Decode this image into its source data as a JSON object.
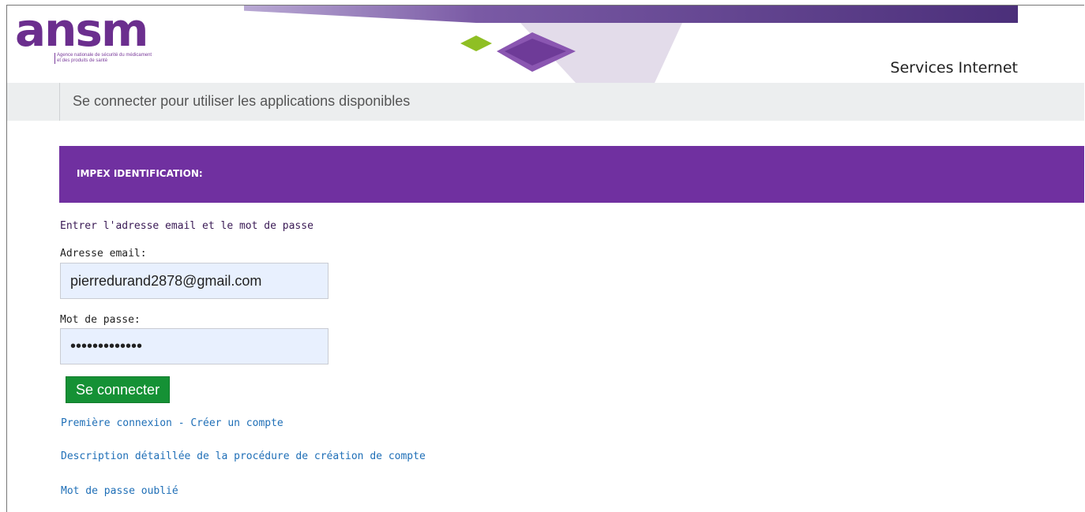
{
  "header": {
    "logo_text": "ansm",
    "logo_tagline_line1": "Agence nationale de sécurité du médicament",
    "logo_tagline_line2": "et des produits de santé",
    "site_title": "Services Internet"
  },
  "subheader": {
    "text": "Se connecter pour utiliser les applications disponibles"
  },
  "identification": {
    "title": "IMPEX IDENTIFICATION:",
    "instruction": "Entrer l'adresse email et le mot de passe",
    "email_label": "Adresse email:",
    "email_value": "pierredurand2878@gmail.com",
    "password_label": "Mot de passe:",
    "password_value": "•••••••••••••",
    "login_button": "Se connecter"
  },
  "links": {
    "first_login": "Première connexion - Créer un compte",
    "procedure_description": "Description détaillée de la procédure de création de compte",
    "forgot_password": "Mot de passe oublié"
  },
  "colors": {
    "brand_purple": "#7030a0",
    "button_green": "#159135",
    "link_blue": "#1f6fb7"
  }
}
